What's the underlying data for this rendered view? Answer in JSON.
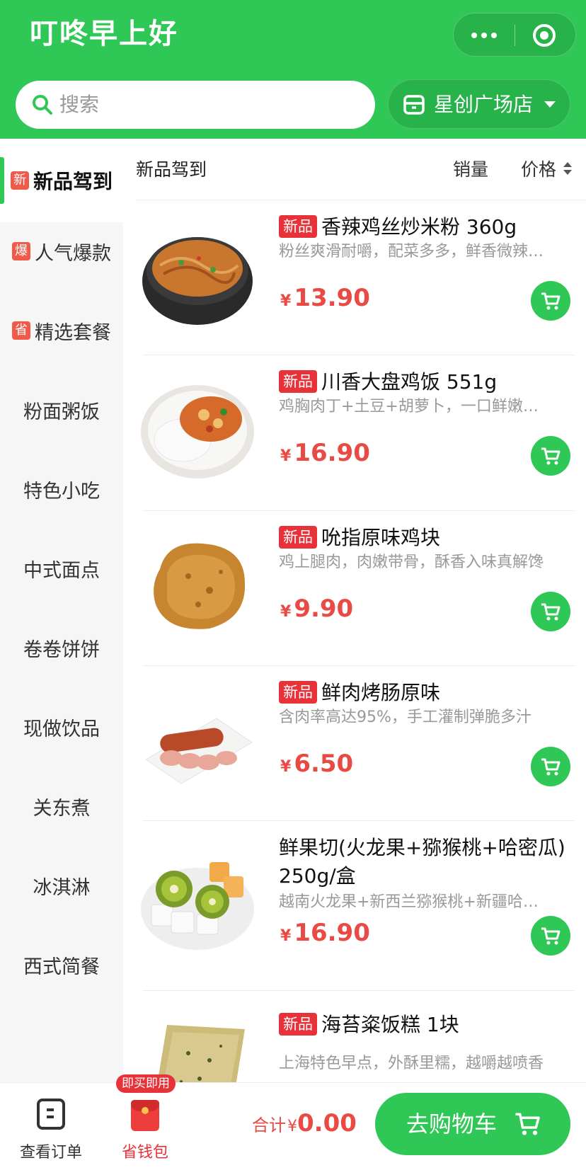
{
  "header": {
    "logo_text": "叮咚早上好",
    "search_placeholder": "搜索",
    "store_name": "星创广场店"
  },
  "sidebar": {
    "items": [
      {
        "label": "新品驾到",
        "badge": "新",
        "active": true
      },
      {
        "label": "人气爆款",
        "badge": "爆"
      },
      {
        "label": "精选套餐",
        "badge": "省"
      },
      {
        "label": "粉面粥饭"
      },
      {
        "label": "特色小吃"
      },
      {
        "label": "中式面点"
      },
      {
        "label": "卷卷饼饼"
      },
      {
        "label": "现做饮品"
      },
      {
        "label": "关东煮"
      },
      {
        "label": "冰淇淋"
      },
      {
        "label": "西式简餐"
      }
    ]
  },
  "content_header": {
    "title": "新品驾到",
    "sort_sales": "销量",
    "sort_price": "价格"
  },
  "products": [
    {
      "tag": "新品",
      "name": "香辣鸡丝炒米粉 360g",
      "desc": "粉丝爽滑耐嚼，配菜多多，鲜香微辣…",
      "currency": "¥",
      "price": "13.90"
    },
    {
      "tag": "新品",
      "name": "川香大盘鸡饭 551g",
      "desc": "鸡胸肉丁+土豆+胡萝卜，一口鲜嫩…",
      "currency": "¥",
      "price": "16.90"
    },
    {
      "tag": "新品",
      "name": "吮指原味鸡块",
      "desc": "鸡上腿肉，肉嫩带骨，酥香入味真解馋",
      "currency": "¥",
      "price": "9.90"
    },
    {
      "tag": "新品",
      "name": "鲜肉烤肠原味",
      "desc": "含肉率高达95%，手工灌制弹脆多汁",
      "currency": "¥",
      "price": "6.50"
    },
    {
      "tag": "",
      "name": "鲜果切(火龙果+猕猴桃+哈密瓜) 250g/盒",
      "desc": "越南火龙果+新西兰猕猴桃+新疆哈…",
      "currency": "¥",
      "price": "16.90"
    },
    {
      "tag": "新品",
      "name": "海苔粢饭糕 1块",
      "desc": "上海特色早点，外酥里糯，越嚼越喷香",
      "currency": "¥",
      "price": ""
    }
  ],
  "bottom_bar": {
    "orders_label": "查看订单",
    "wallet_tip": "即买即用",
    "wallet_label": "省钱包",
    "total_label": "合计",
    "currency": "¥",
    "total_amount": "0.00",
    "checkout_label": "去购物车"
  },
  "colors": {
    "brand_green": "#2fc755",
    "price_red": "#ea4a44",
    "tag_red": "#e8323a"
  },
  "icons": [
    "more-dots-icon",
    "target-icon",
    "search-icon",
    "store-icon",
    "caret-down-icon",
    "sort-icon",
    "cart-icon",
    "order-icon",
    "red-packet-icon"
  ]
}
